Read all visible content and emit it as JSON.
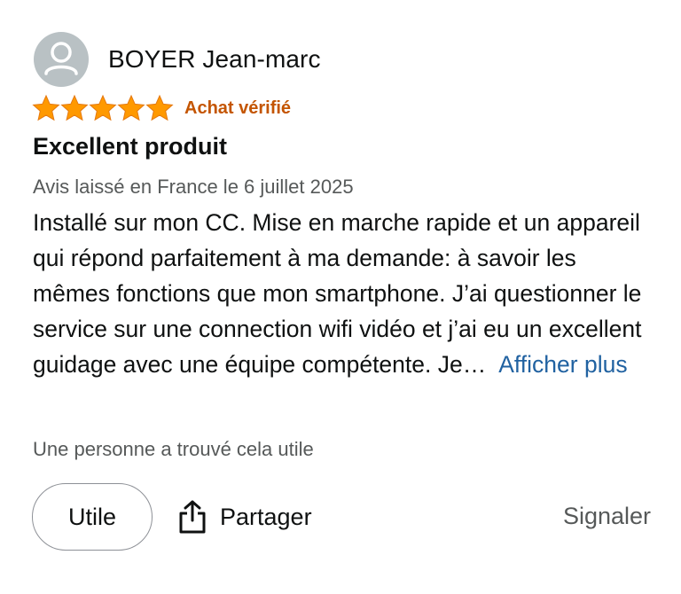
{
  "review": {
    "author": {
      "name": "BOYER Jean-marc",
      "avatar_icon": "user-silhouette-icon"
    },
    "rating": {
      "stars": 5,
      "max": 5,
      "star_color": "#ff9900"
    },
    "verified_label": "Achat vérifié",
    "title": "Excellent produit",
    "meta": "Avis laissé en France le 6 juillet 2025",
    "body": "Installé sur mon CC. Mise en marche rapide et un appareil qui répond parfaitement à ma demande: à savoir les mêmes fonctions que mon smartphone. J’ai questionner le service sur une connection wifi vidéo et j’ai eu un excellent guidage avec une équipe compétente. Je…",
    "read_more_label": "Afficher plus",
    "helpful_count_text": "Une personne a trouvé cela utile"
  },
  "actions": {
    "helpful_label": "Utile",
    "share_label": "Partager",
    "share_icon": "share-icon",
    "report_label": "Signaler"
  },
  "colors": {
    "verified": "#c45500",
    "link": "#2162a1",
    "muted": "#565959",
    "text": "#0f1111"
  }
}
